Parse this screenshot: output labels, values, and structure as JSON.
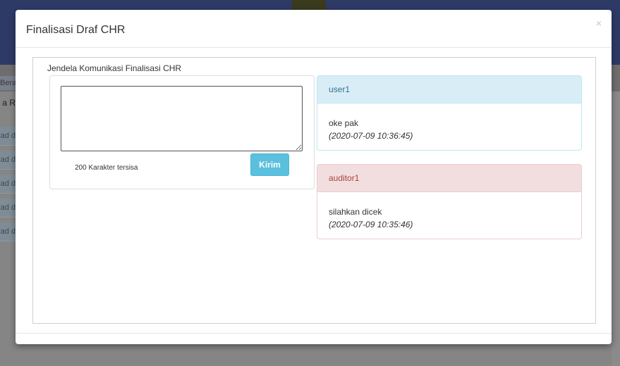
{
  "background": {
    "nav_fragment": "Beran",
    "side_label": "a R",
    "side_buttons": [
      "ad d",
      "ad d",
      "ad d",
      "ad d",
      "ad d"
    ]
  },
  "modal": {
    "title": "Finalisasi Draf CHR",
    "close_icon": "×",
    "section_label": "Jendela Komunikasi Finalisasi CHR",
    "compose": {
      "textarea_value": "",
      "char_remaining": "200 Karakter tersisa",
      "send_label": "Kirim"
    },
    "messages": [
      {
        "sender": "user1",
        "text": "oke pak",
        "timestamp": "(2020-07-09 10:36:45)",
        "style": "info"
      },
      {
        "sender": "auditor1",
        "text": "silahkan dicek",
        "timestamp": "(2020-07-09 10:35:46)",
        "style": "danger"
      }
    ]
  },
  "colors": {
    "send_button": "#5bc0de",
    "info_header": "#d9edf7",
    "info_text": "#31708f",
    "danger_header": "#f2dede",
    "danger_text": "#a94442"
  }
}
